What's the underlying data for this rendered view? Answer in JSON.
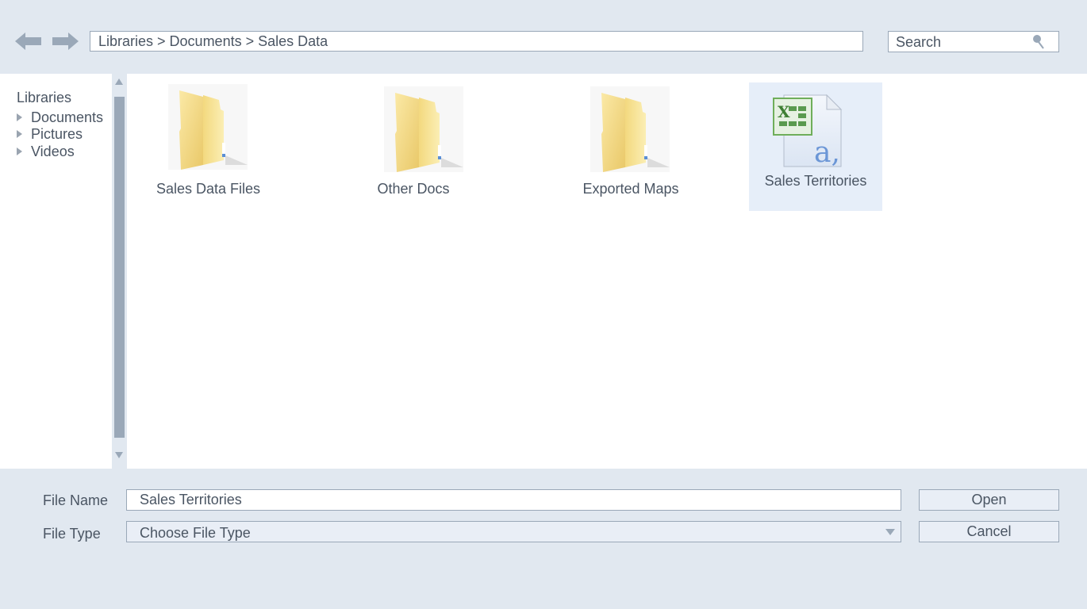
{
  "toolbar": {
    "back_icon": "arrow-left-icon",
    "forward_icon": "arrow-right-icon",
    "address": "Libraries > Documents > Sales Data",
    "search_placeholder": "Search",
    "search_icon": "magnifier-icon"
  },
  "sidebar": {
    "root": "Libraries",
    "items": [
      {
        "label": "Documents"
      },
      {
        "label": "Pictures"
      },
      {
        "label": "Videos"
      }
    ]
  },
  "content": {
    "items": [
      {
        "label": "Sales Data Files",
        "type": "folder",
        "selected": false
      },
      {
        "label": "Other Docs",
        "type": "folder",
        "selected": false
      },
      {
        "label": "Exported Maps",
        "type": "folder",
        "selected": false
      },
      {
        "label": "Sales Territories",
        "type": "excel-file",
        "selected": true
      }
    ]
  },
  "footer": {
    "file_name_label": "File Name",
    "file_name_value": "Sales Territories",
    "file_type_label": "File Type",
    "file_type_value": "Choose File Type",
    "open_label": "Open",
    "cancel_label": "Cancel"
  },
  "colors": {
    "chrome": "#e1e8f0",
    "border": "#9aa8b8",
    "text": "#4a5563",
    "selection": "#e6eef9"
  }
}
